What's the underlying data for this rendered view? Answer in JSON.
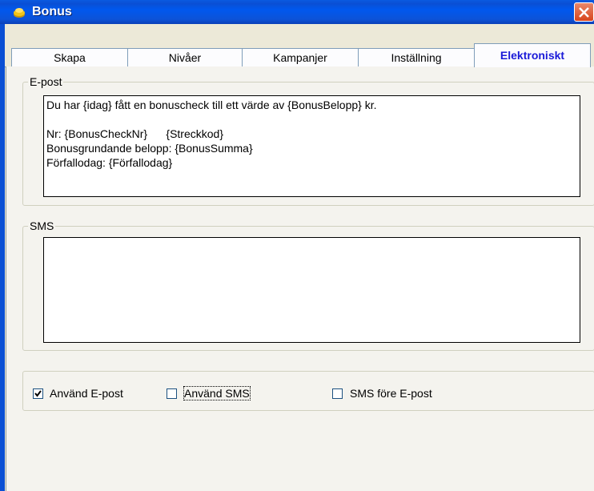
{
  "window": {
    "title": "Bonus",
    "icon": "coins-icon"
  },
  "tabs": [
    {
      "label": "Skapa",
      "active": false
    },
    {
      "label": "Nivåer",
      "active": false
    },
    {
      "label": "Kampanjer",
      "active": false
    },
    {
      "label": "Inställning",
      "active": false
    },
    {
      "label": "Elektroniskt",
      "active": true
    }
  ],
  "email": {
    "group_label": "E-post",
    "body": "Du har {idag} fått en bonuscheck till ett värde av {BonusBelopp} kr.\n\nNr: {BonusCheckNr}      {Streckkod}\nBonusgrundande belopp: {BonusSumma}\nFörfallodag: {Förfallodag}"
  },
  "sms": {
    "group_label": "SMS",
    "body": ""
  },
  "options": {
    "use_email": {
      "label": "Använd E-post",
      "checked": true
    },
    "use_sms": {
      "label": "Använd SMS",
      "checked": false
    },
    "sms_before_email": {
      "label": "SMS före E-post",
      "checked": false
    }
  }
}
